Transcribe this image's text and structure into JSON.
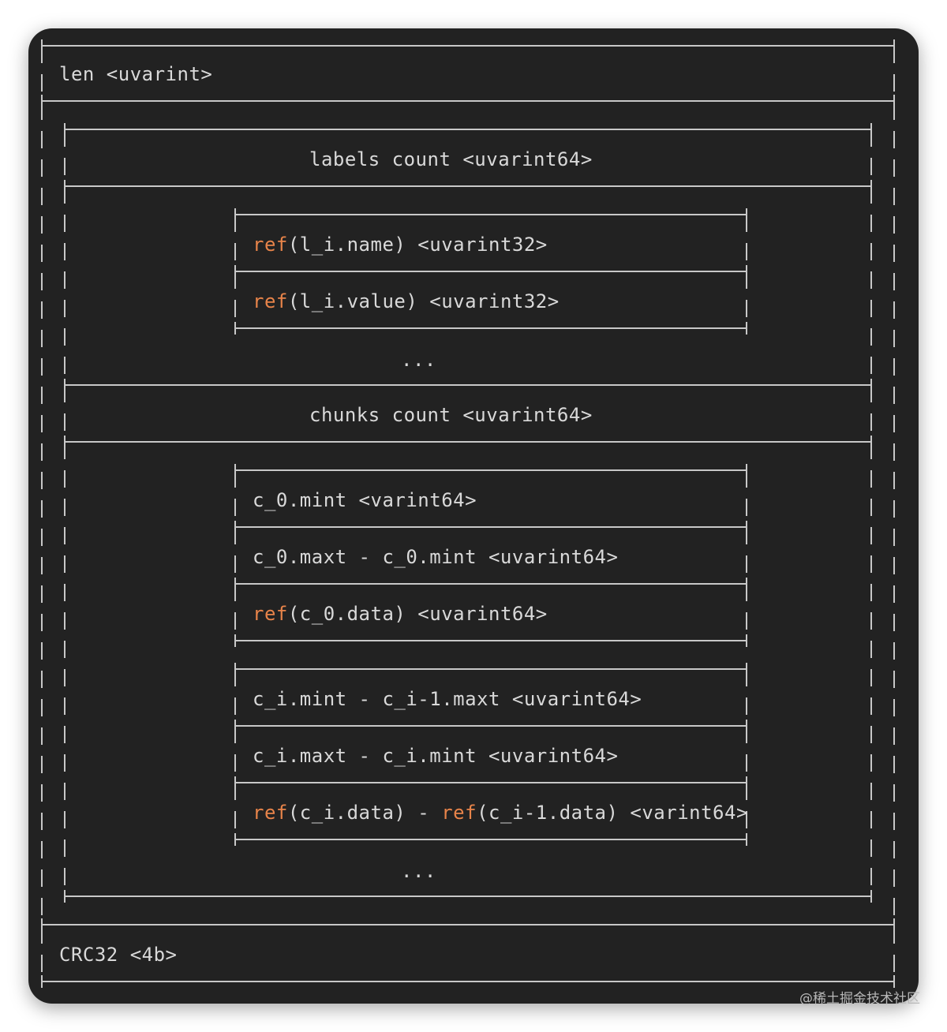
{
  "colors": {
    "background": "#222222",
    "line": "#c8c8c8",
    "text": "#d9d9d9",
    "keyword": "#e8844a",
    "watermark": "#b8b8b8"
  },
  "diagram": {
    "len_field": "len <uvarint>",
    "labels_count": "labels count <uvarint64>",
    "label_ref_name": {
      "keyword": "ref",
      "rest": "(l_i.name) <uvarint32>"
    },
    "label_ref_value": {
      "keyword": "ref",
      "rest": "(l_i.value) <uvarint32>"
    },
    "labels_ellipsis": "...",
    "chunks_count": "chunks count <uvarint64>",
    "chunk0": {
      "mint": "c_0.mint <varint64>",
      "maxt": "c_0.maxt - c_0.mint <uvarint64>",
      "data": {
        "keyword": "ref",
        "rest": "(c_0.data) <uvarint64>"
      }
    },
    "chunki": {
      "mint": "c_i.mint - c_i-1.maxt <uvarint64>",
      "maxt": "c_i.maxt - c_i.mint <uvarint64>",
      "data": {
        "keyword1": "ref",
        "middle": "(c_i.data) - ",
        "keyword2": "ref",
        "rest": "(c_i-1.data) <varint64>"
      }
    },
    "chunks_ellipsis": "...",
    "crc": "CRC32 <4b>"
  },
  "watermark": "@稀土掘金技术社区"
}
